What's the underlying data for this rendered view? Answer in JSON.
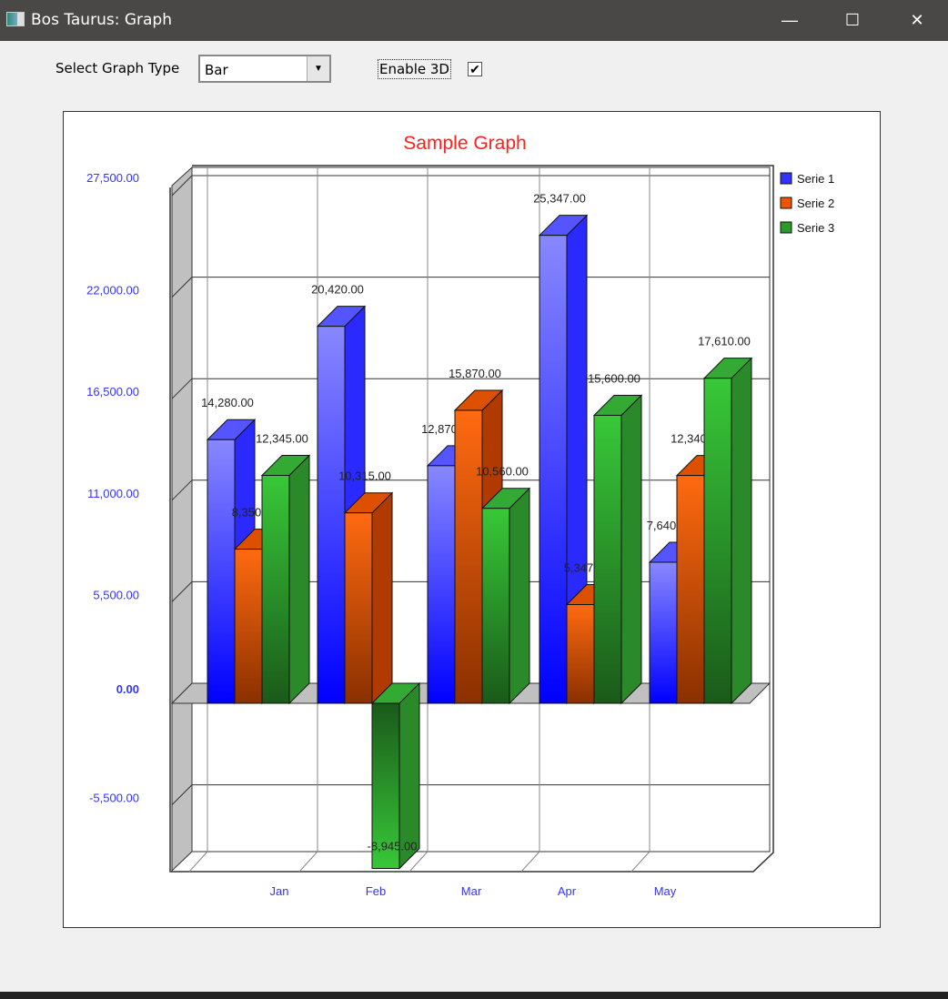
{
  "window": {
    "title": "Bos Taurus: Graph",
    "minimize": "—",
    "maximize": "☐",
    "close": "✕"
  },
  "controls": {
    "graph_type_label": "Select Graph Type",
    "graph_type_value": "Bar",
    "enable3d_label": "Enable 3D",
    "enable3d_checked": true,
    "check_glyph": "✔",
    "arrow_glyph": "▼"
  },
  "chart_data": {
    "type": "bar",
    "title": "Sample Graph",
    "three_d": true,
    "categories": [
      "Jan",
      "Feb",
      "Mar",
      "Apr",
      "May"
    ],
    "series": [
      {
        "name": "Serie 1",
        "color": "#3333ff",
        "values": [
          14280,
          20420,
          12870,
          25347,
          7640
        ]
      },
      {
        "name": "Serie 2",
        "color": "#ee5500",
        "values": [
          8350,
          10315,
          15870,
          5347,
          12340
        ]
      },
      {
        "name": "Serie 3",
        "color": "#2a9a2a",
        "values": [
          12345,
          -8945,
          10560,
          15600,
          17610
        ]
      }
    ],
    "yticks": [
      27500,
      22000,
      16500,
      11000,
      5500,
      0,
      -5500
    ],
    "ytick_labels": [
      "27,500.00",
      "22,000.00",
      "16,500.00",
      "11,000.00",
      "5,500.00",
      "0.00",
      "-5,500.00"
    ],
    "value_labels": [
      [
        "14,280.00",
        "20,420.00",
        "12,870.00",
        "25,347.00",
        "7,640.00"
      ],
      [
        "8,350.00",
        "10,315.00",
        "15,870.00",
        "5,347.00",
        "12,340.00"
      ],
      [
        "12,345.00",
        "-8,945.00",
        "10,560.00",
        "15,600.00",
        "17,610.00"
      ]
    ],
    "legend": "top-right",
    "grid": true
  }
}
